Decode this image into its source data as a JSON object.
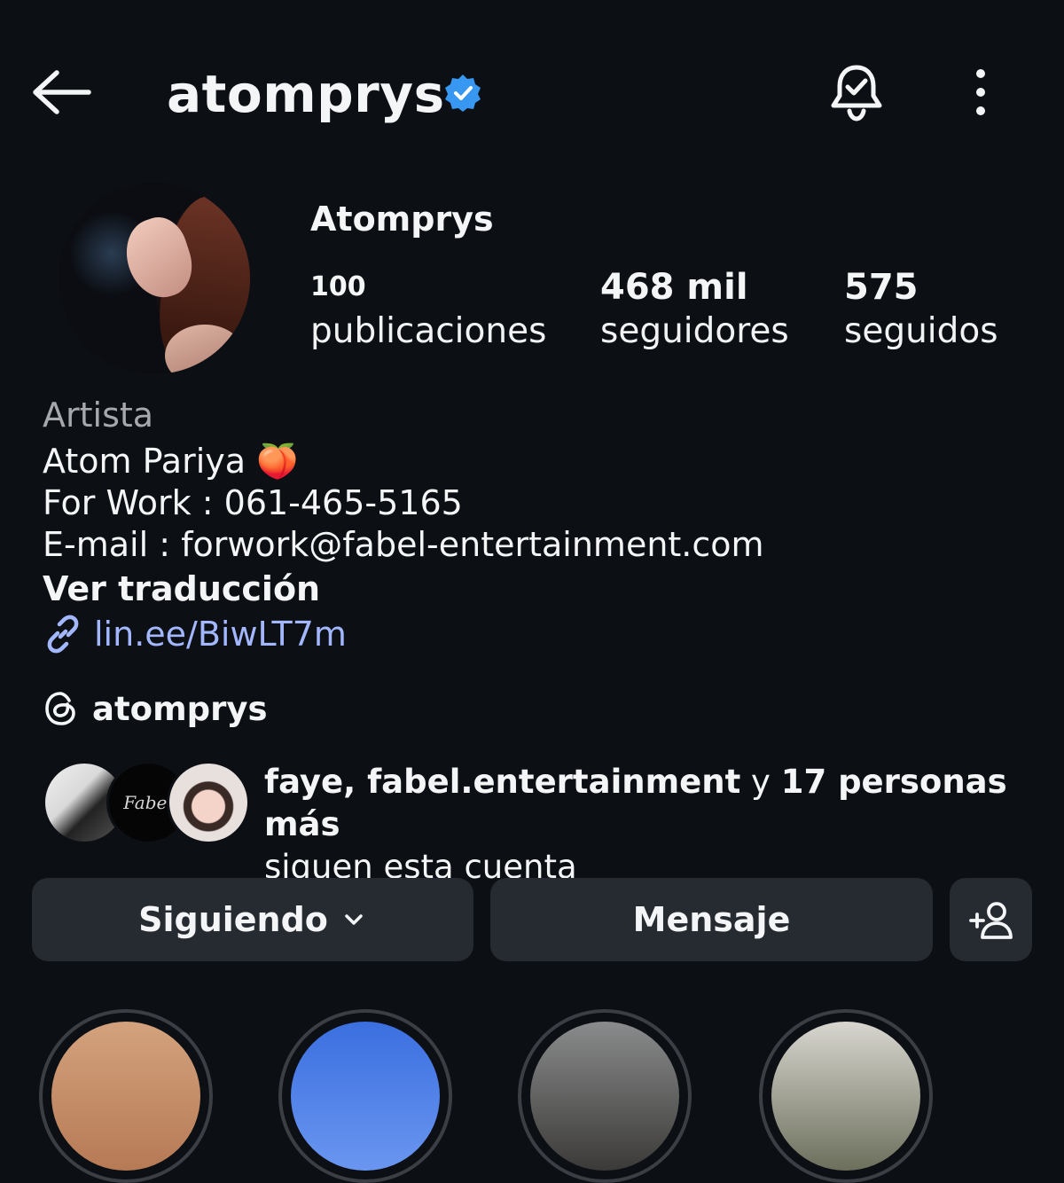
{
  "header": {
    "username": "atomprys",
    "icons": [
      "back-arrow-icon",
      "verified-badge-icon",
      "notification-bell-icon",
      "more-options-icon"
    ]
  },
  "profile": {
    "display_name": "Atomprys",
    "stats": {
      "posts": {
        "value": "100",
        "label": "publicaciones"
      },
      "followers": {
        "value": "468 mil",
        "label": "seguidores"
      },
      "following": {
        "value": "575",
        "label": "seguidos"
      }
    }
  },
  "bio": {
    "category": "Artista",
    "line1": "Atom Pariya 🍑",
    "line2": "For Work : 061-465-5165",
    "line3": "E-mail : forwork@fabel-entertainment.com",
    "translate": "Ver traducción",
    "link": "lin.ee/BiwLT7m",
    "threads_handle": "atomprys"
  },
  "mutual": {
    "names": "faye, fabel.entertainment",
    "connector": " y ",
    "others": "17 personas más",
    "suffix": "siguen esta cuenta",
    "avatar2_text": "Fabel"
  },
  "actions": {
    "following_label": "Siguiendo",
    "message_label": "Mensaje"
  },
  "colors": {
    "background": "#0c0f14",
    "button": "#262a31",
    "link": "#a3b7ff",
    "verified": "#3897f0",
    "muted": "#a6a8ad"
  }
}
